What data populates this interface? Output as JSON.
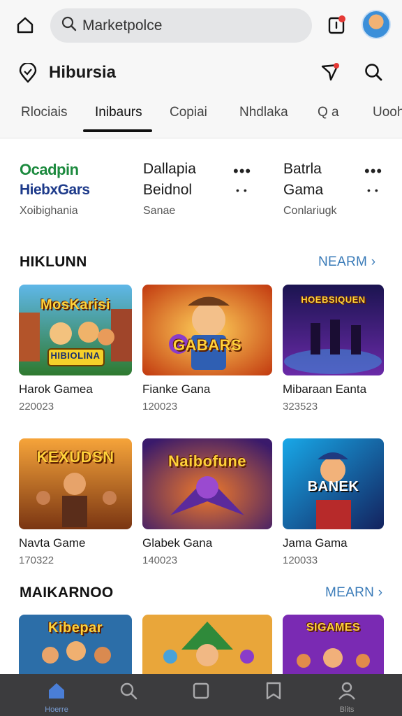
{
  "topbar": {
    "search_text": "Marketpolce",
    "icons": [
      "home-icon",
      "search-icon",
      "inbox-icon",
      "avatar"
    ]
  },
  "header": {
    "title": "Hibursia",
    "icons": [
      "location-icon",
      "filter-icon",
      "search-icon"
    ]
  },
  "tabs": [
    {
      "label": "Rlociais"
    },
    {
      "label": "Inibaurs",
      "active": true
    },
    {
      "label": "Copiai"
    },
    {
      "label": "Nhdlaka"
    },
    {
      "label": "Q a"
    },
    {
      "label": "Uooh"
    }
  ],
  "featured": [
    {
      "line1": "Ocadpin",
      "line2": "HiebxGars",
      "sub": "Xoibighania"
    },
    {
      "line1": "Dallapia",
      "line2": "Beidnol",
      "sub": "Sanae"
    },
    {
      "line1": "Batrla",
      "line2": "Gama",
      "sub": "Conlariugk"
    }
  ],
  "sections": [
    {
      "title": "HIKLUNN",
      "link": "NEARM",
      "cards": [
        {
          "art_text": "MosKarisi",
          "art_sub": "HIBIOLINA",
          "name": "Harok Gamea",
          "count": "220023"
        },
        {
          "art_text": "GABARS",
          "name": "Fianke Gana",
          "count": "120023"
        },
        {
          "art_text": "HOEBSIQUEN",
          "name": "Mibaraan Eanta",
          "count": "323523"
        }
      ]
    },
    {
      "title": "",
      "link": "",
      "cards": [
        {
          "art_text": "KEXUDSN",
          "name": "Navta Game",
          "count": "170322"
        },
        {
          "art_text": "Naibofune",
          "name": "Glabek Gana",
          "count": "140023"
        },
        {
          "art_text": "BANEK",
          "name": "Jama Gama",
          "count": "120033"
        }
      ]
    },
    {
      "title": "MAIKARNOO",
      "link": "MEARN",
      "cards": [
        {
          "art_text": "Kibepar"
        },
        {
          "art_text": ""
        },
        {
          "art_text": "SIGAMES"
        }
      ]
    }
  ],
  "bottom_nav": [
    {
      "icon": "home-icon",
      "label": "Hoerre",
      "active": true
    },
    {
      "icon": "search-icon",
      "label": ""
    },
    {
      "icon": "library-icon",
      "label": ""
    },
    {
      "icon": "bookmark-icon",
      "label": ""
    },
    {
      "icon": "profile-icon",
      "label": "Blits"
    }
  ],
  "colors": {
    "accent_link": "#3a7bb8",
    "nav_bg": "#3c3c3e",
    "nav_active": "#4a7ed6",
    "badge": "#e53935"
  }
}
